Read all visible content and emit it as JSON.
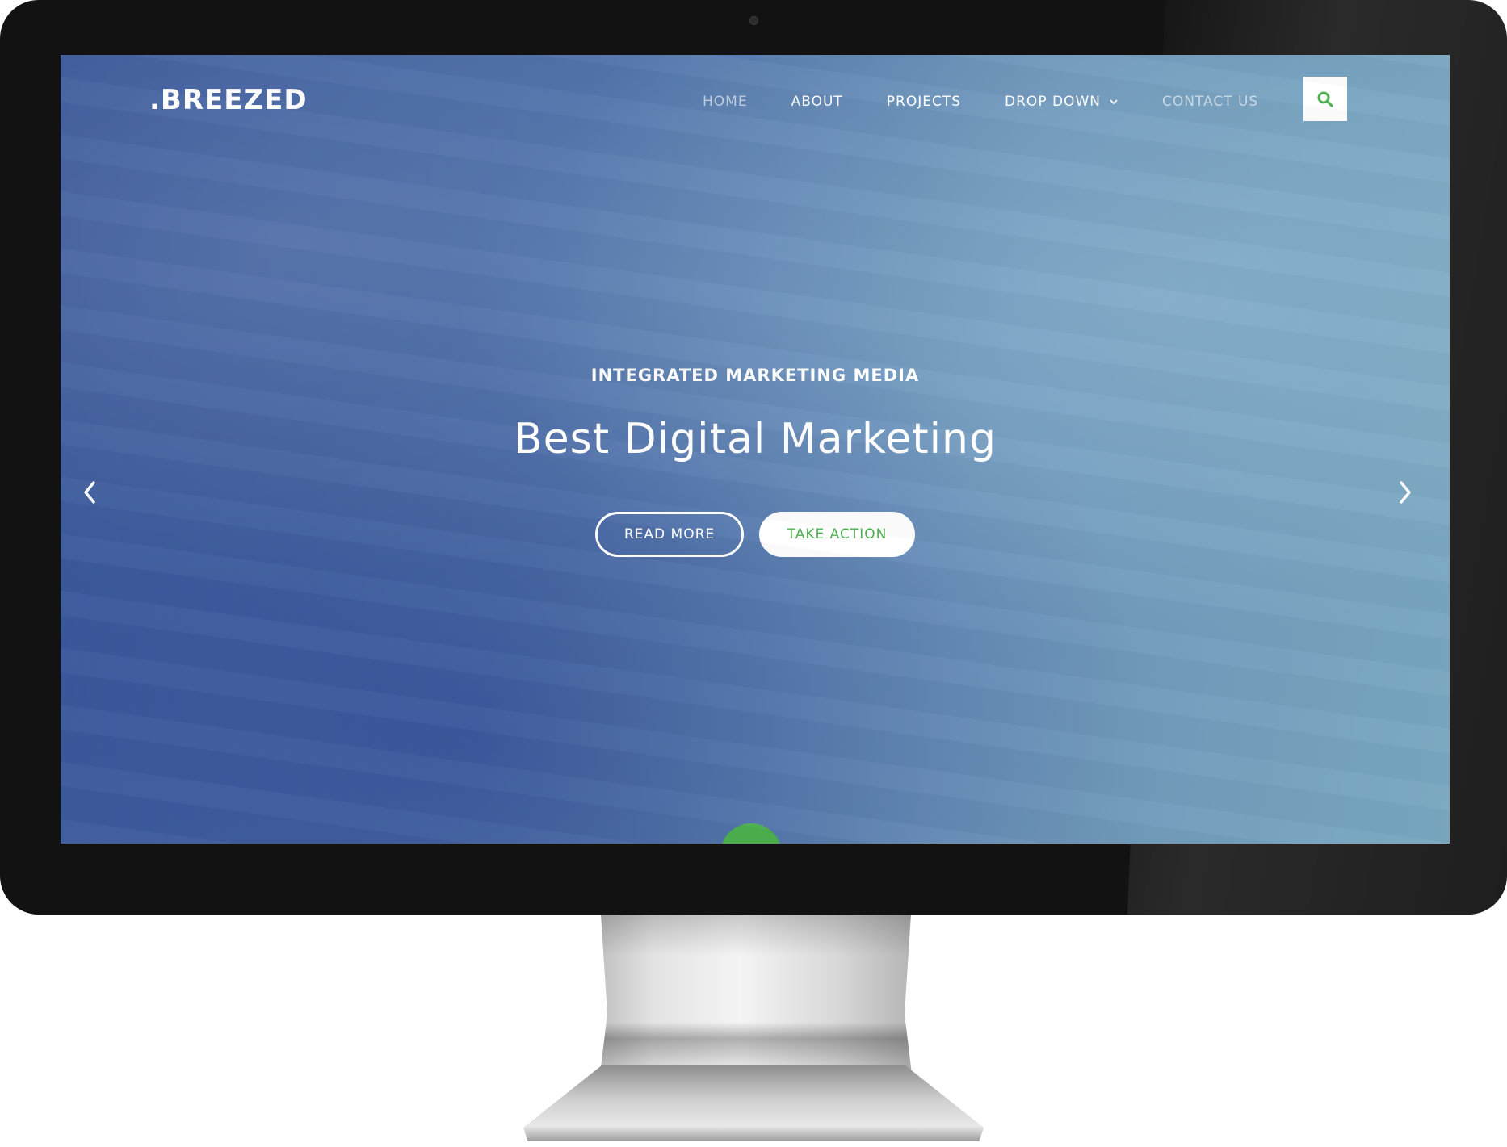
{
  "site": {
    "logo": ".BREEZED"
  },
  "nav": {
    "items": [
      {
        "label": "HOME",
        "muted": true
      },
      {
        "label": "ABOUT",
        "muted": false
      },
      {
        "label": "PROJECTS",
        "muted": false
      },
      {
        "label": "DROP DOWN",
        "muted": false,
        "has_dropdown": true
      },
      {
        "label": "CONTACT US",
        "muted": true
      }
    ],
    "search_icon": "search-icon",
    "dropdown_icon": "chevron-down-icon"
  },
  "hero": {
    "kicker": "INTEGRATED MARKETING MEDIA",
    "title": "Best Digital Marketing",
    "read_more": "READ MORE",
    "take_action": "TAKE ACTION"
  },
  "carousel": {
    "prev_icon": "chevron-left-icon",
    "next_icon": "chevron-right-icon"
  },
  "colors": {
    "accent": "#4caf50",
    "sky_dark": "#3c5a9c",
    "sky_light": "#79a8c0",
    "bezel": "#121212"
  }
}
